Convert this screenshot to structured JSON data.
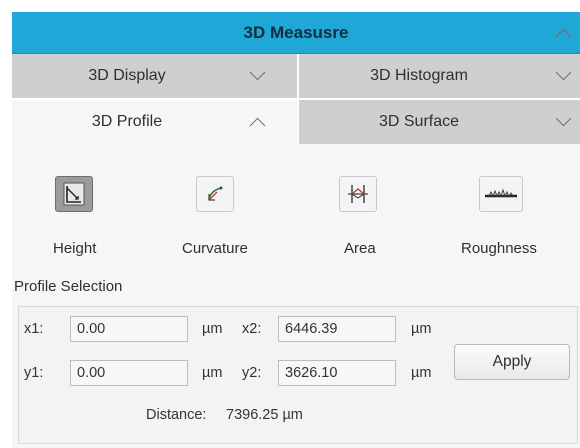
{
  "panel": {
    "title": "3D Measusre",
    "title_chevron": "chevron-up-icon",
    "accent_color": "#1fa7d8"
  },
  "tabs": [
    {
      "label": "3D Display",
      "state": "collapsed",
      "chevron": "chevron-down-icon"
    },
    {
      "label": "3D Histogram",
      "state": "collapsed",
      "chevron": "chevron-down-icon"
    },
    {
      "label": "3D Profile",
      "state": "expanded",
      "chevron": "chevron-up-icon"
    },
    {
      "label": "3D Surface",
      "state": "collapsed",
      "chevron": "chevron-down-icon"
    }
  ],
  "tools": [
    {
      "label": "Height",
      "icon": "height-icon",
      "selected": true
    },
    {
      "label": "Curvature",
      "icon": "curvature-icon",
      "selected": false
    },
    {
      "label": "Area",
      "icon": "area-icon",
      "selected": false
    },
    {
      "label": "Roughness",
      "icon": "roughness-icon",
      "selected": false
    }
  ],
  "profile": {
    "section_label": "Profile Selection",
    "x1_label": "x1:",
    "x1_value": "0.00",
    "y1_label": "y1:",
    "y1_value": "0.00",
    "x2_label": "x2:",
    "x2_value": "6446.39",
    "y2_label": "y2:",
    "y2_value": "3626.10",
    "unit": "µm",
    "apply_label": "Apply",
    "distance_label": "Distance:",
    "distance_value": "7396.25 µm"
  }
}
